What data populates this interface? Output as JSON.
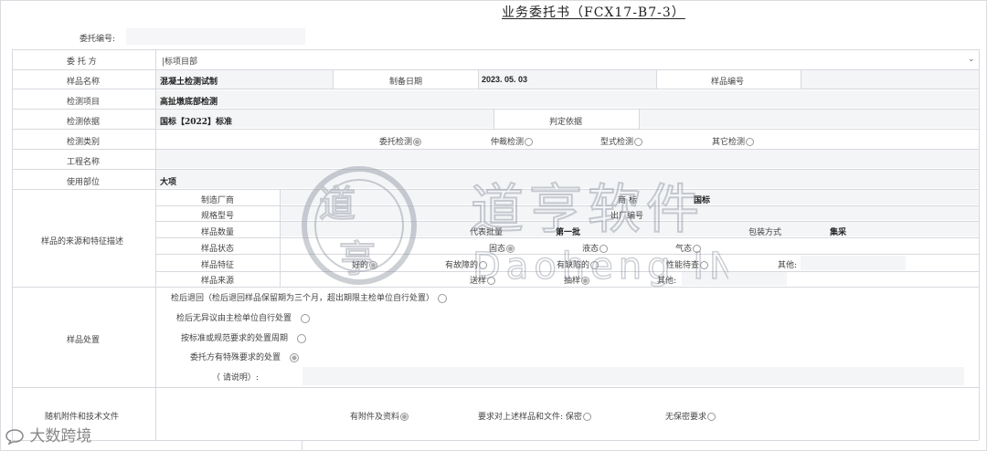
{
  "title": "业务委托书（FCX17-B7-3）",
  "entrust_no": {
    "label": "委托编号:",
    "value": ""
  },
  "rows": {
    "client": {
      "label": "委 托 方",
      "value": "|标项目部"
    },
    "sample_name": {
      "label": "样品名称",
      "value": "混凝土检测试制"
    },
    "prep_date": {
      "label": "制备日期",
      "value": "2023. 05. 03"
    },
    "sample_no": {
      "label": "样品编号",
      "value": ""
    },
    "test_item": {
      "label": "检测项目",
      "value": "高扯墩底部检测"
    },
    "test_basis": {
      "label": "检测依据",
      "value": "国标【2022】标准"
    },
    "judge_basis": {
      "label": "判定依据",
      "value": ""
    },
    "test_type": {
      "label": "检测类别",
      "options": [
        "委托检测",
        "仲裁检测",
        "型式检测",
        "其它检测"
      ],
      "selected": 0
    },
    "project": {
      "label": "工程名称",
      "value": ""
    },
    "use_part": {
      "label": "使用部位",
      "value": "大项"
    }
  },
  "source": {
    "label": "样品的来源和特征描述",
    "manufacturer": {
      "label": "制造厂商",
      "value": ""
    },
    "brand": {
      "label": "商  标",
      "value": "国标"
    },
    "spec": {
      "label": "规格型号",
      "value": ""
    },
    "factory_no": {
      "label": "出厂编号",
      "value": ""
    },
    "quantity": {
      "label": "样品数量",
      "value": ""
    },
    "batch": {
      "label": "代表批量",
      "value": "第一批"
    },
    "packing": {
      "label": "包装方式",
      "value": "集采"
    },
    "state": {
      "label": "样品状态",
      "options": [
        "固态",
        "液态",
        "气态"
      ],
      "selected": 0
    },
    "feature": {
      "label": "样品特征",
      "options": [
        "好的",
        "有故障的",
        "有缺陷的",
        "性能待查"
      ],
      "other_label": "其他:",
      "other_value": "",
      "selected": 0
    },
    "origin": {
      "label": "样品来源",
      "options": [
        "送样",
        "抽样"
      ],
      "other_label": "其他:",
      "other_value": "",
      "selected": 1
    }
  },
  "disposal": {
    "label": "样品处置",
    "options": [
      "检后退回（检后退回样品保留期为三个月，超出期限主检单位自行处置）",
      "检后无异议由主检单位自行处置",
      "按标准或规范要求的处置周期",
      "委托方有特殊要求的处置"
    ],
    "selected": 3,
    "note_label": "（ 请说明）:",
    "note_value": ""
  },
  "attachments": {
    "label": "随机附件和技术文件",
    "options": [
      "有附件及资料",
      "要求对上述样品和文件: 保密",
      "无保密要求"
    ],
    "selected": 0
  },
  "watermark": {
    "cn": "道亨软件",
    "en": "Daoheng INC"
  },
  "brand_footer": "大数跨境",
  "colors": {
    "border": "#d7d9de",
    "cell": "#f4f5f7",
    "text": "#444444"
  },
  "icons": {
    "dropdown": "chevron-down-icon",
    "brand": "chat-bubble-icon"
  }
}
